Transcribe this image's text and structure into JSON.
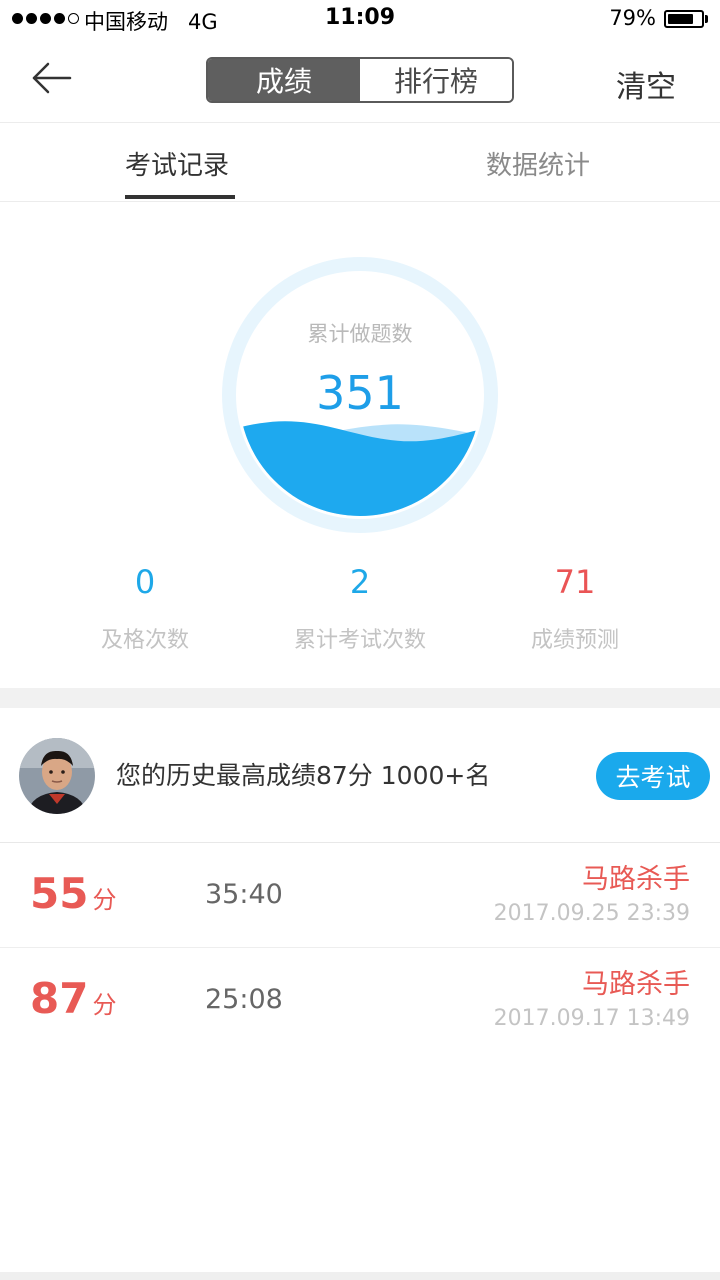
{
  "status_bar": {
    "signal_dots": 5,
    "signal_filled": 4,
    "carrier": "中国移动",
    "network": "4G",
    "time": "11:09",
    "battery_percent": "79%",
    "battery_level": 0.79
  },
  "nav": {
    "back_icon": "arrow-left-icon",
    "segments": [
      "成绩",
      "排行榜"
    ],
    "active_segment": 0,
    "clear_label": "清空"
  },
  "tabs": {
    "records": "考试记录",
    "stats": "数据统计",
    "active": "records"
  },
  "progress_circle": {
    "label": "累计做题数",
    "value": "351",
    "fill_level": 0.35,
    "colors": {
      "ring": "#e7f5fd",
      "fill": "#1ea9ef",
      "back_wave": "#b9e2fa"
    }
  },
  "stats": [
    {
      "value": "0",
      "label": "及格次数",
      "color": "#1ea8e8"
    },
    {
      "value": "2",
      "label": "累计考试次数",
      "color": "#1ea8e8"
    },
    {
      "value": "71",
      "label": "成绩预测",
      "color": "#ea5455"
    }
  ],
  "best": {
    "text": "您的历史最高成绩87分 1000+名",
    "button_label": "去考试",
    "avatar_icon": "user-avatar-photo"
  },
  "records": [
    {
      "score": "55",
      "unit": "分",
      "duration": "35:40",
      "name": "马路杀手",
      "date": "2017.09.25 23:39"
    },
    {
      "score": "87",
      "unit": "分",
      "duration": "25:08",
      "name": "马路杀手",
      "date": "2017.09.17 13:49"
    }
  ]
}
